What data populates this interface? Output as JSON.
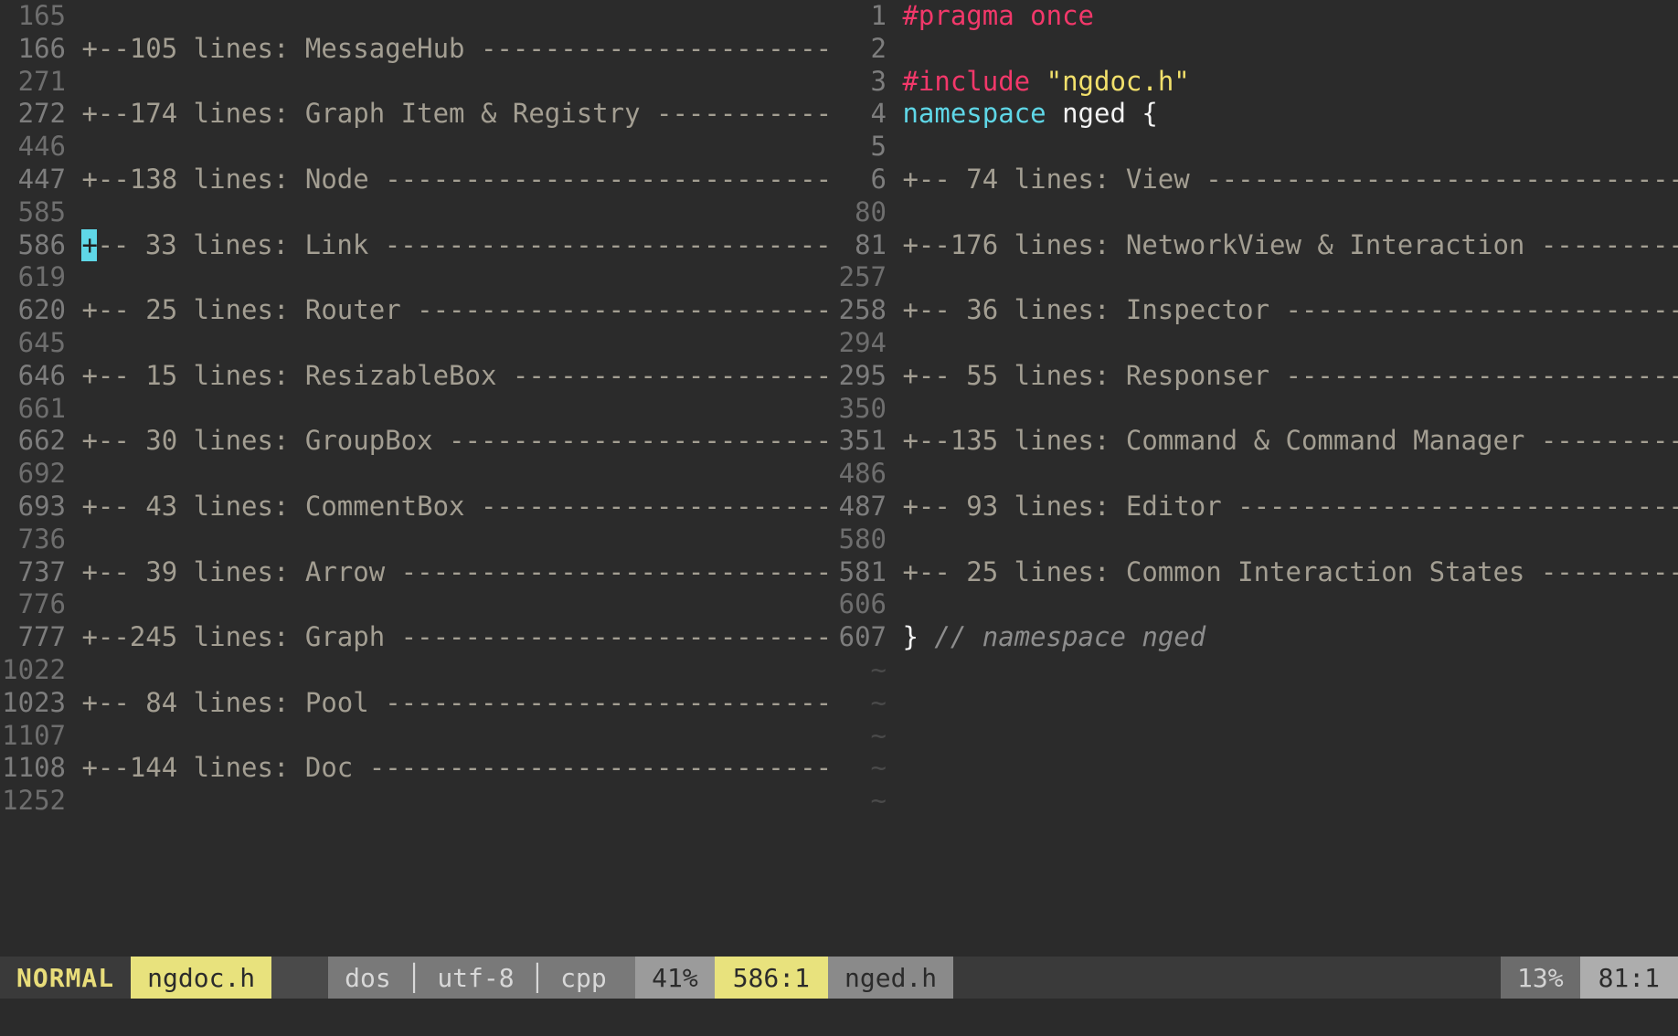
{
  "window": {
    "app": "vim",
    "background": "#2b2b2b",
    "accent": "#e8e27d",
    "cursor_color": "#5fd7e7"
  },
  "left_pane": {
    "file": "ngdoc.h",
    "rows": [
      {
        "num": "165",
        "kind": "endnum",
        "text": ""
      },
      {
        "num": "166",
        "kind": "fold",
        "count": "105",
        "title": "MessageHub",
        "prefix": "+--",
        "cursor": false
      },
      {
        "num": "271",
        "kind": "endnum",
        "text": ""
      },
      {
        "num": "272",
        "kind": "fold",
        "count": "174",
        "title": "Graph Item & Registry",
        "prefix": "+--",
        "cursor": false
      },
      {
        "num": "446",
        "kind": "endnum",
        "text": ""
      },
      {
        "num": "447",
        "kind": "fold",
        "count": "138",
        "title": "Node",
        "prefix": "+--",
        "cursor": false
      },
      {
        "num": "585",
        "kind": "endnum",
        "text": ""
      },
      {
        "num": "586",
        "kind": "fold",
        "count": " 33",
        "title": "Link",
        "prefix": "+--",
        "cursor": true
      },
      {
        "num": "619",
        "kind": "endnum",
        "text": ""
      },
      {
        "num": "620",
        "kind": "fold",
        "count": " 25",
        "title": "Router",
        "prefix": "+--",
        "cursor": false
      },
      {
        "num": "645",
        "kind": "endnum",
        "text": ""
      },
      {
        "num": "646",
        "kind": "fold",
        "count": " 15",
        "title": "ResizableBox",
        "prefix": "+--",
        "cursor": false
      },
      {
        "num": "661",
        "kind": "endnum",
        "text": ""
      },
      {
        "num": "662",
        "kind": "fold",
        "count": " 30",
        "title": "GroupBox",
        "prefix": "+--",
        "cursor": false
      },
      {
        "num": "692",
        "kind": "endnum",
        "text": ""
      },
      {
        "num": "693",
        "kind": "fold",
        "count": " 43",
        "title": "CommentBox",
        "prefix": "+--",
        "cursor": false
      },
      {
        "num": "736",
        "kind": "endnum",
        "text": ""
      },
      {
        "num": "737",
        "kind": "fold",
        "count": " 39",
        "title": "Arrow",
        "prefix": "+--",
        "cursor": false
      },
      {
        "num": "776",
        "kind": "endnum",
        "text": ""
      },
      {
        "num": "777",
        "kind": "fold",
        "count": "245",
        "title": "Graph",
        "prefix": "+--",
        "cursor": false
      },
      {
        "num": "1022",
        "kind": "endnum",
        "text": ""
      },
      {
        "num": "1023",
        "kind": "fold",
        "count": " 84",
        "title": "Pool",
        "prefix": "+--",
        "cursor": false
      },
      {
        "num": "1107",
        "kind": "endnum",
        "text": ""
      },
      {
        "num": "1108",
        "kind": "fold",
        "count": "144",
        "title": "Doc",
        "prefix": "+--",
        "cursor": false
      },
      {
        "num": "1252",
        "kind": "endnum",
        "text": ""
      }
    ],
    "fold_label": " lines: ",
    "status": {
      "mode": "NORMAL",
      "filename": "ngdoc.h",
      "fileformat": "dos",
      "encoding": "utf-8",
      "filetype": "cpp",
      "info": "dos │ utf-8 │ cpp",
      "percent": "41%",
      "position": "586:1"
    }
  },
  "right_pane": {
    "file": "nged.h",
    "rows": [
      {
        "num": "1",
        "kind": "code",
        "tokens": [
          {
            "t": "#pragma once",
            "c": "s-pre"
          }
        ]
      },
      {
        "num": "2",
        "kind": "code",
        "tokens": []
      },
      {
        "num": "3",
        "kind": "code",
        "tokens": [
          {
            "t": "#include ",
            "c": "s-pre"
          },
          {
            "t": "\"ngdoc.h\"",
            "c": "s-str"
          }
        ]
      },
      {
        "num": "4",
        "kind": "code",
        "tokens": [
          {
            "t": "namespace ",
            "c": "s-kw"
          },
          {
            "t": "nged ",
            "c": "s-id"
          },
          {
            "t": "{",
            "c": "s-punc"
          }
        ]
      },
      {
        "num": "5",
        "kind": "code",
        "tokens": []
      },
      {
        "num": "6",
        "kind": "fold",
        "count": " 74",
        "title": "View",
        "prefix": "+--"
      },
      {
        "num": "80",
        "kind": "endnum",
        "text": ""
      },
      {
        "num": "81",
        "kind": "fold",
        "count": "176",
        "title": "NetworkView & Interaction",
        "prefix": "+--"
      },
      {
        "num": "257",
        "kind": "endnum",
        "text": ""
      },
      {
        "num": "258",
        "kind": "fold",
        "count": " 36",
        "title": "Inspector",
        "prefix": "+--"
      },
      {
        "num": "294",
        "kind": "endnum",
        "text": ""
      },
      {
        "num": "295",
        "kind": "fold",
        "count": " 55",
        "title": "Responser",
        "prefix": "+--"
      },
      {
        "num": "350",
        "kind": "endnum",
        "text": ""
      },
      {
        "num": "351",
        "kind": "fold",
        "count": "135",
        "title": "Command & Command Manager",
        "prefix": "+--"
      },
      {
        "num": "486",
        "kind": "endnum",
        "text": ""
      },
      {
        "num": "487",
        "kind": "fold",
        "count": " 93",
        "title": "Editor",
        "prefix": "+--"
      },
      {
        "num": "580",
        "kind": "endnum",
        "text": ""
      },
      {
        "num": "581",
        "kind": "fold",
        "count": " 25",
        "title": "Common Interaction States",
        "prefix": "+--"
      },
      {
        "num": "606",
        "kind": "endnum",
        "text": ""
      },
      {
        "num": "607",
        "kind": "code",
        "tokens": [
          {
            "t": "} ",
            "c": "s-punc"
          },
          {
            "t": "// namespace nged",
            "c": "s-cmt"
          }
        ]
      },
      {
        "num": "~",
        "kind": "tilde",
        "text": "~"
      },
      {
        "num": "~",
        "kind": "tilde",
        "text": "~"
      },
      {
        "num": "~",
        "kind": "tilde",
        "text": "~"
      },
      {
        "num": "~",
        "kind": "tilde",
        "text": "~"
      },
      {
        "num": "~",
        "kind": "tilde",
        "text": "~"
      }
    ],
    "fold_label": " lines: ",
    "status": {
      "filename": "nged.h",
      "percent": "13%",
      "position": "81:1"
    }
  }
}
